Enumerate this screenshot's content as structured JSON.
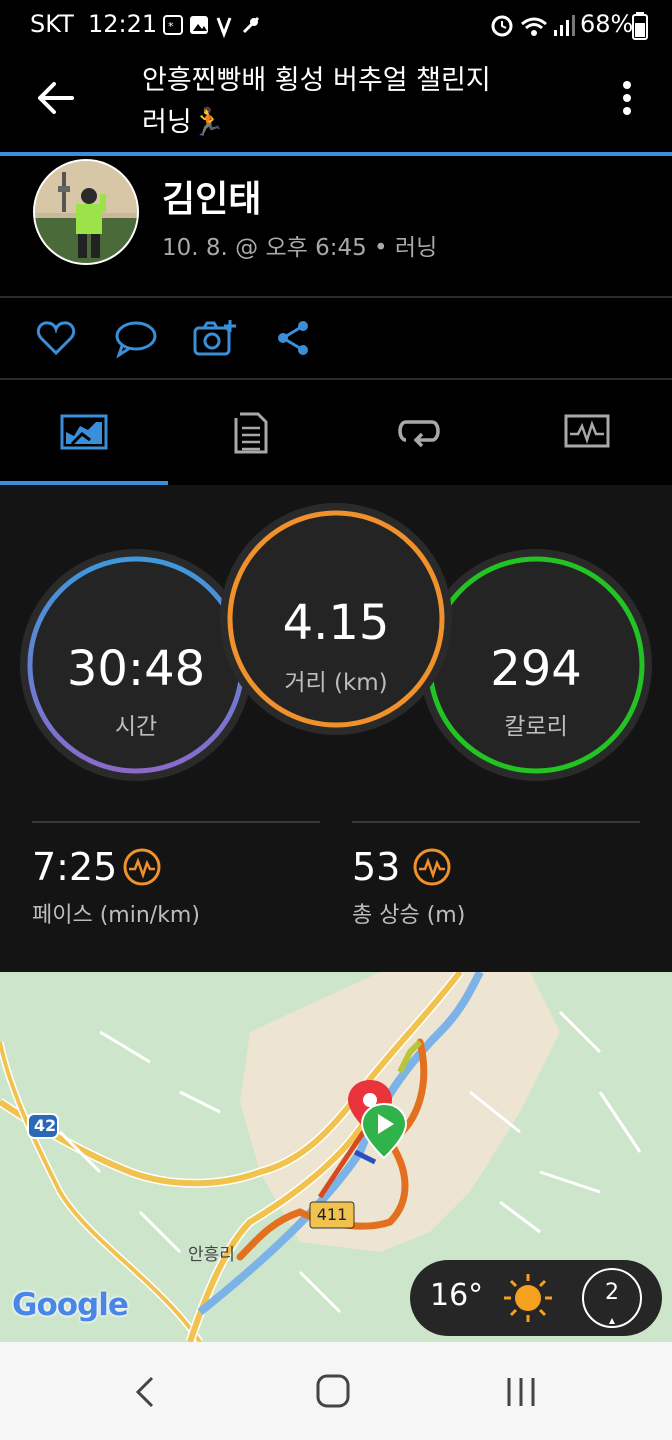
{
  "status_bar": {
    "carrier": "SKT",
    "time": "12:21",
    "battery": "68%"
  },
  "header": {
    "title_line1": "안흥찐빵배 횡성 버추얼 챌린지",
    "title_line2": "러닝🏃"
  },
  "profile": {
    "name": "김인태",
    "meta": "10. 8. @ 오후 6:45 • 러닝"
  },
  "stats": {
    "time_value": "30:48",
    "time_label": "시간",
    "distance_value": "4.15",
    "distance_label": "거리 (km)",
    "calories_value": "294",
    "calories_label": "칼로리",
    "pace_value": "7:25",
    "pace_label": "페이스 (min/km)",
    "elev_value": "53",
    "elev_label": "총 상승 (m)"
  },
  "map": {
    "road_42": "42",
    "road_411": "411",
    "place_label": "안흥리",
    "google": "Google",
    "weather_temp": "16°",
    "wind": "2"
  },
  "colors": {
    "accent": "#3b8fd8",
    "orange": "#f0912b",
    "green": "#22c322",
    "purple": "#7a5ec4"
  }
}
